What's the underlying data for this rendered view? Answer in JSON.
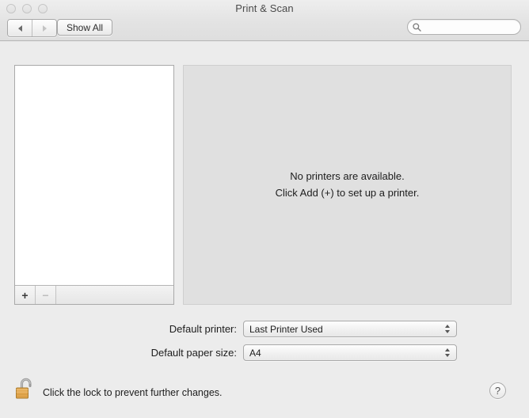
{
  "window": {
    "title": "Print & Scan",
    "traffic_lights": [
      "close",
      "minimize",
      "zoom"
    ]
  },
  "toolbar": {
    "back_label": "Back",
    "forward_label": "Forward",
    "show_all_label": "Show All",
    "search": {
      "value": "",
      "placeholder": ""
    }
  },
  "printer_list": {
    "items": [],
    "add_label": "+",
    "remove_label": "−"
  },
  "content": {
    "empty_state_line1": "No printers are available.",
    "empty_state_line2": "Click Add (+) to set up a printer."
  },
  "settings": [
    {
      "label": "Default printer:",
      "value": "Last Printer Used"
    },
    {
      "label": "Default paper size:",
      "value": "A4"
    }
  ],
  "lock": {
    "message": "Click the lock to prevent further changes.",
    "state": "unlocked"
  },
  "help": {
    "label": "?"
  },
  "colors": {
    "window_bg": "#ececec",
    "titlebar_bg": "#e3e3e3",
    "content_panel_bg": "#e0e0e0",
    "list_bg": "#ffffff",
    "text": "#1d1d1d",
    "lock_body": "#e0a550"
  }
}
